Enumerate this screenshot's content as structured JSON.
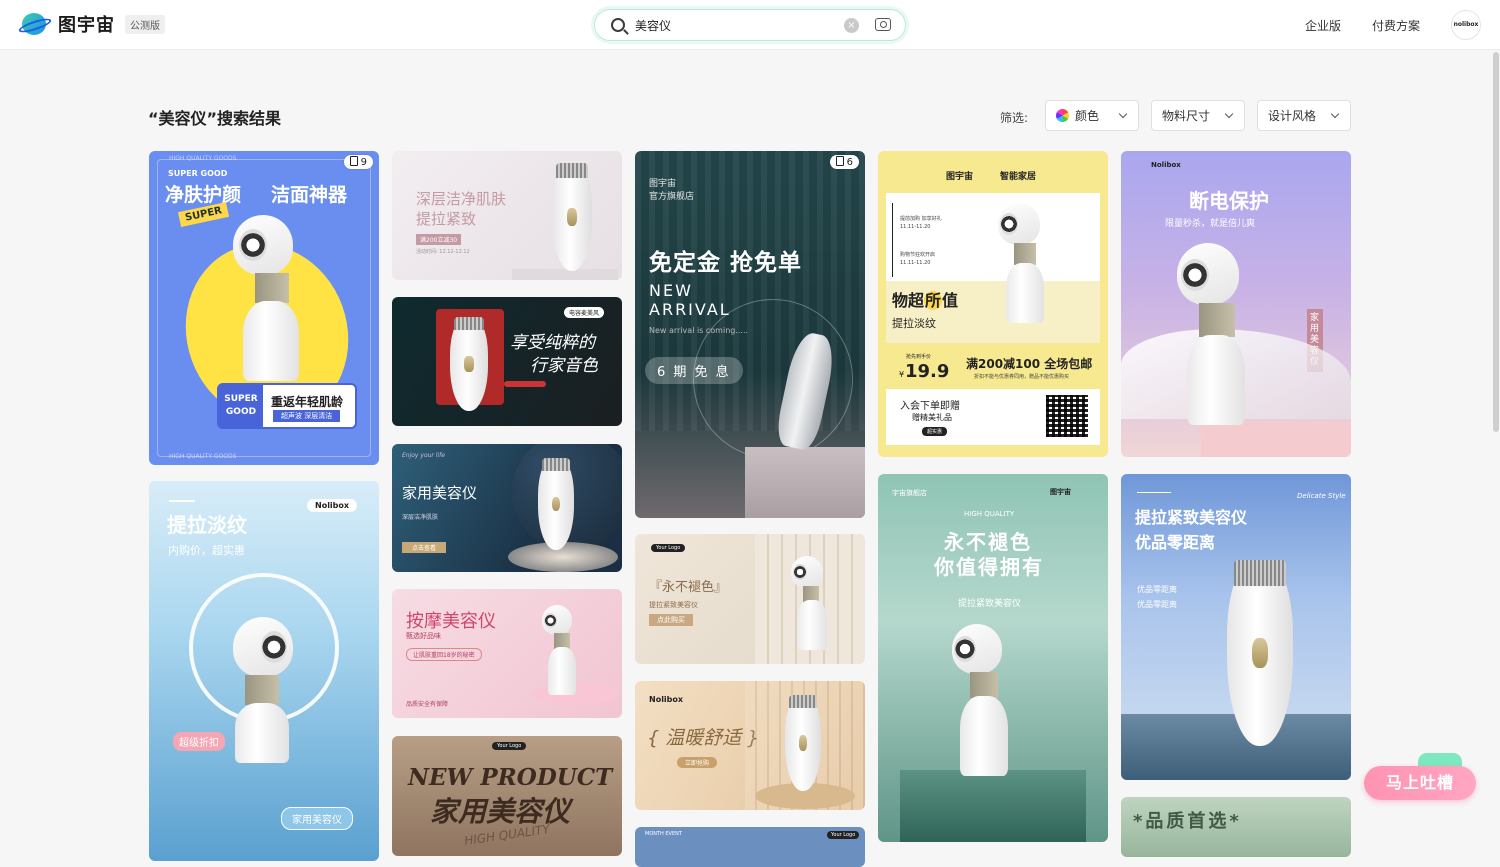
{
  "header": {
    "logo_name": "图宇宙",
    "logo_badge": "公测版",
    "search_value": "美容仪",
    "nav": [
      "企业版",
      "付费方案"
    ],
    "avatar_text": "nolibox"
  },
  "results": {
    "title": "“美容仪”搜索结果",
    "filter_label": "筛选:",
    "filters": [
      {
        "label": "颜色",
        "icon": "color-wheel-icon"
      },
      {
        "label": "物料尺寸"
      },
      {
        "label": "设计风格"
      }
    ]
  },
  "cards": {
    "c1": {
      "badge": "9",
      "tag1": "SUPER GOOD",
      "title1": "净肤护颜",
      "title2": "洁面神器",
      "sticker": "SUPER",
      "box_small": "SUPER GOOD",
      "box_title": "重返年轻肌龄",
      "box_sub": "超声波 深层清洁",
      "edge": "HIGH QUALITY GOODS"
    },
    "c2": {
      "title1": "深层洁净肌肤",
      "title2": "提拉紧致",
      "tag": "满200立减30",
      "date": "活动时间: 12.12-12.12"
    },
    "c3": {
      "tag": "电容麦美风",
      "title1": "享受纯粹的",
      "title2": "行家音色"
    },
    "c4": {
      "small": "Enjoy your life",
      "title": "家用美容仪",
      "sub": "深层洁净肌肤",
      "btn": "点击查看"
    },
    "c5": {
      "title": "按摩美容仪",
      "sub": "甄选好品味",
      "tag": "让肌肤重回18岁的秘密",
      "foot": "品质安全有保障"
    },
    "c6": {
      "logo": "Your Logo",
      "title1": "NEW PRODUCT",
      "title2": "家用美容仪",
      "sub": "HIGH QUALITY"
    },
    "c7": {
      "badge": "6",
      "brand1": "图宇宙",
      "brand2": "官方旗舰店",
      "title": "免定金 抢免单",
      "en1": "NEW",
      "en2": "ARRIVAL",
      "en_sub": "New arrival is coming.....",
      "pill": "6 期 免 息"
    },
    "c8": {
      "logo": "Your Logo",
      "title": "『永不褪色』",
      "sub": "提拉紧致美容仪",
      "btn": "点此购买"
    },
    "c9": {
      "logo": "Nolibox",
      "title": "{ 温暖舒适 }",
      "btn": "立即抢购"
    },
    "c10": {
      "logo": "Your Logo",
      "small": "MONTH EVENT"
    },
    "c11": {
      "brand": "图宇宙",
      "header2": "智能家居",
      "line1": "提前加购 加享好礼",
      "date1": "11.11-11.20",
      "line2": "购物节狂欢开启",
      "date2": "11.11-11.20",
      "title_a": "物超",
      "title_b": "所",
      "title_c": "值",
      "sub": "提拉淡纹",
      "price_label": "抢先到手价",
      "price_symbol": "¥",
      "price": "19.9",
      "promo": "满200减100 全场包邮",
      "promo_sub": "折扣不能与优惠券同用，赠品不能优惠购买",
      "gift1": "入会下单即赠",
      "gift2": "赠精美礼品",
      "gift_btn": "超实惠"
    },
    "c12": {
      "brand": "宇宙旗舰店",
      "logo": "图宇宙",
      "hq": "HIGH QUALITY",
      "title1": "永不褪色",
      "title2": "你值得拥有",
      "sub": "提拉紧致美容仪"
    },
    "c13": {
      "logo": "Nolibox",
      "title": "断电保护",
      "sub": "限量秒杀，就是倍儿爽",
      "side": "家用美容仪"
    },
    "c14": {
      "logo": "Nolibox",
      "title": "提拉淡纹",
      "sub": "内购价，超实惠",
      "pill1": "超级折扣",
      "pill2": "家用美容仪"
    },
    "c15": {
      "script": "Delicate Style",
      "title1": "提拉紧致美容仪",
      "title2": "优品零距离",
      "sub1": "优品零距离",
      "sub2": "优品零距离"
    },
    "c16": {
      "title": "品质首选"
    }
  },
  "feedback_label": "马上吐槽",
  "colors": {
    "accent_green": "#3ad0a8",
    "accent_pink": "#ff93b2",
    "primary_blue": "#1d5fe0"
  }
}
